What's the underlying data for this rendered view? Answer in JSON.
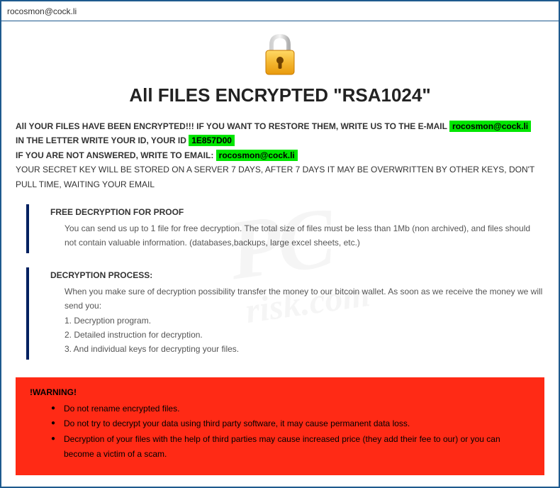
{
  "titlebar": {
    "title": "rocosmon@cock.li"
  },
  "heading": "All FILES ENCRYPTED \"RSA1024\"",
  "intro": {
    "line1_prefix": "All YOUR FILES HAVE BEEN ENCRYPTED!!! IF YOU WANT TO RESTORE THEM, WRITE US TO THE E-MAIL ",
    "email1": "rocosmon@cock.li",
    "line2_prefix": "IN THE LETTER WRITE YOUR ID, YOUR ID ",
    "id": "1E857D00",
    "line3_prefix": "IF YOU ARE NOT ANSWERED, WRITE TO EMAIL: ",
    "email2": "rocosmon@cock.li",
    "line4": "YOUR SECRET KEY WILL BE STORED ON A SERVER 7 DAYS, AFTER 7 DAYS IT MAY BE OVERWRITTEN BY OTHER KEYS, DON'T PULL TIME, WAITING YOUR EMAIL"
  },
  "proof": {
    "title": "FREE DECRYPTION FOR PROOF",
    "body": "You can send us up to 1 file for free decryption. The total size of files must be less than 1Mb (non archived), and files should not contain valuable information. (databases,backups, large excel sheets, etc.)"
  },
  "process": {
    "title": "DECRYPTION PROCESS:",
    "intro": "When you make sure of decryption possibility transfer the money to our bitcoin wallet. As soon as we receive the money we will send you:",
    "item1": "1. Decryption program.",
    "item2": "2. Detailed instruction for decryption.",
    "item3": "3. And individual keys for decrypting your files."
  },
  "warning": {
    "title": "!WARNING!",
    "item1": "Do not rename encrypted files.",
    "item2": "Do not try to decrypt your data using third party software, it may cause permanent data loss.",
    "item3": "Decryption of your files with the help of third parties may cause increased price (they add their fee to our) or you can become a victim of a scam."
  },
  "watermark": {
    "main": "PC",
    "sub": "risk.com"
  }
}
